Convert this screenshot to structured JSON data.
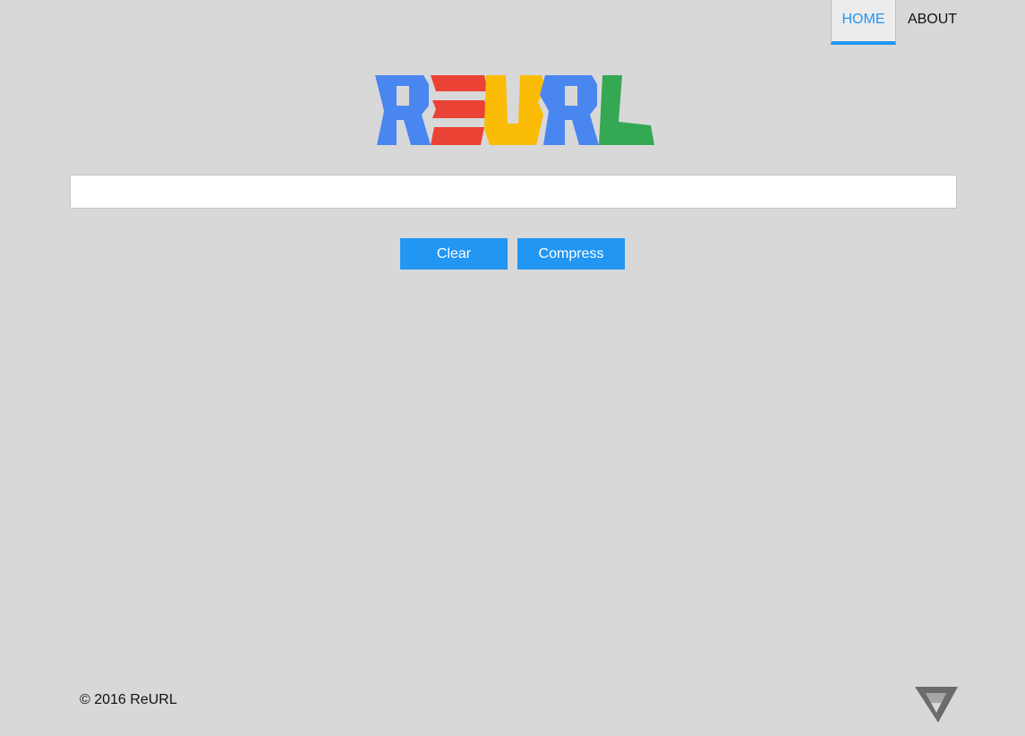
{
  "nav": {
    "items": [
      {
        "label": "HOME",
        "active": true
      },
      {
        "label": "ABOUT",
        "active": false
      }
    ]
  },
  "logo": {
    "text": "REURL",
    "colors": [
      "#4a86f0",
      "#ea4335",
      "#fbbc05",
      "#4a86f0",
      "#34a853"
    ]
  },
  "input": {
    "value": "",
    "placeholder": ""
  },
  "buttons": {
    "clear_label": "Clear",
    "compress_label": "Compress"
  },
  "footer": {
    "copyright": "© 2016 ReURL"
  },
  "colors": {
    "accent": "#2196f3",
    "background": "#d8d8d8"
  }
}
